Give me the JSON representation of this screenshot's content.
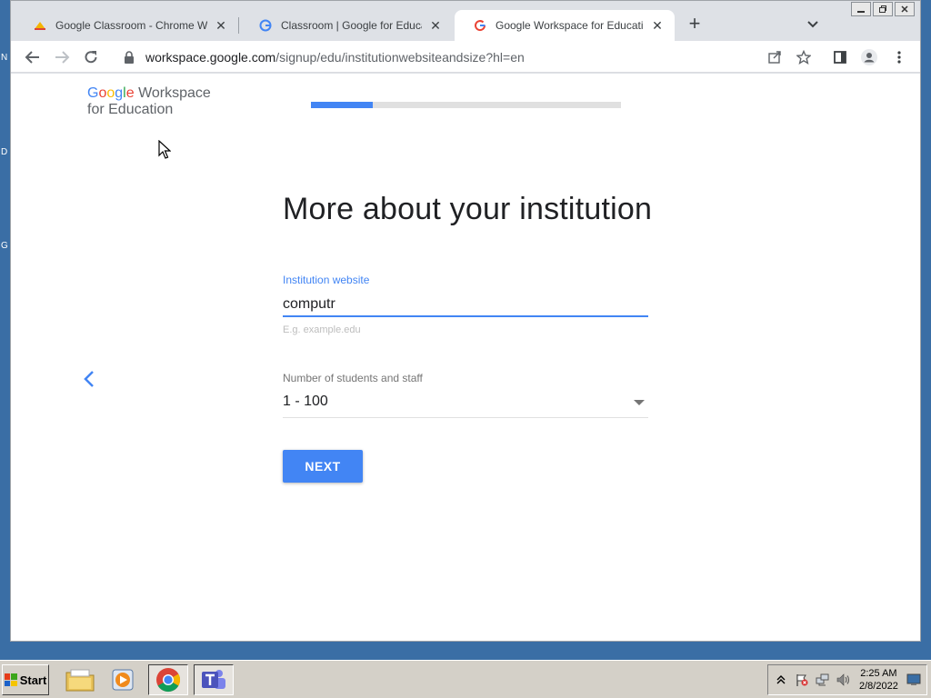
{
  "desktop": {
    "fragments": [
      "N",
      "D",
      "G"
    ]
  },
  "tabs": [
    {
      "title": "Google Classroom - Chrome Web St",
      "favicon": "classroom-icon",
      "close": "✕"
    },
    {
      "title": "Classroom | Google for Education",
      "favicon": "google-g-icon",
      "close": "✕"
    },
    {
      "title": "Google Workspace for Education",
      "favicon": "google-g-icon",
      "close": "✕",
      "active": true
    }
  ],
  "tabstrip": {
    "new_tab": "+",
    "tab_search": "chevron-down-icon"
  },
  "window_controls": [
    "minimize-icon",
    "restore-icon",
    "close-icon"
  ],
  "toolbar": {
    "icons": [
      "back-arrow-icon",
      "forward-arrow-icon",
      "reload-icon",
      "share-icon",
      "star-icon",
      "side-panel-icon",
      "profile-icon",
      "menu-icon"
    ],
    "url_host": "workspace.google.com",
    "url_path": "/signup/edu/institutionwebsiteandsize?hl=en"
  },
  "page": {
    "logo": {
      "brand": "Google",
      "product": "Workspace",
      "line2": "for Education"
    },
    "progress": 0.2,
    "heading": "More about your institution",
    "website": {
      "label": "Institution website",
      "value": "computr",
      "hint": "E.g. example.edu"
    },
    "size": {
      "label": "Number of students and staff",
      "value": "1 - 100"
    },
    "next_label": "NEXT"
  },
  "taskbar": {
    "start_label": "Start",
    "apps": [
      "file-explorer-icon",
      "media-player-icon",
      "chrome-icon",
      "teams-icon"
    ],
    "tray_icons": [
      "show-hidden-icon",
      "action-center-flag-icon",
      "network-icon",
      "volume-icon"
    ],
    "time": "2:25 AM",
    "date": "2/8/2022"
  },
  "colors": {
    "accent": "#4285f4",
    "google_blue": "#4285f4",
    "google_red": "#ea4335",
    "google_yellow": "#fbbc05",
    "google_green": "#34a853"
  }
}
